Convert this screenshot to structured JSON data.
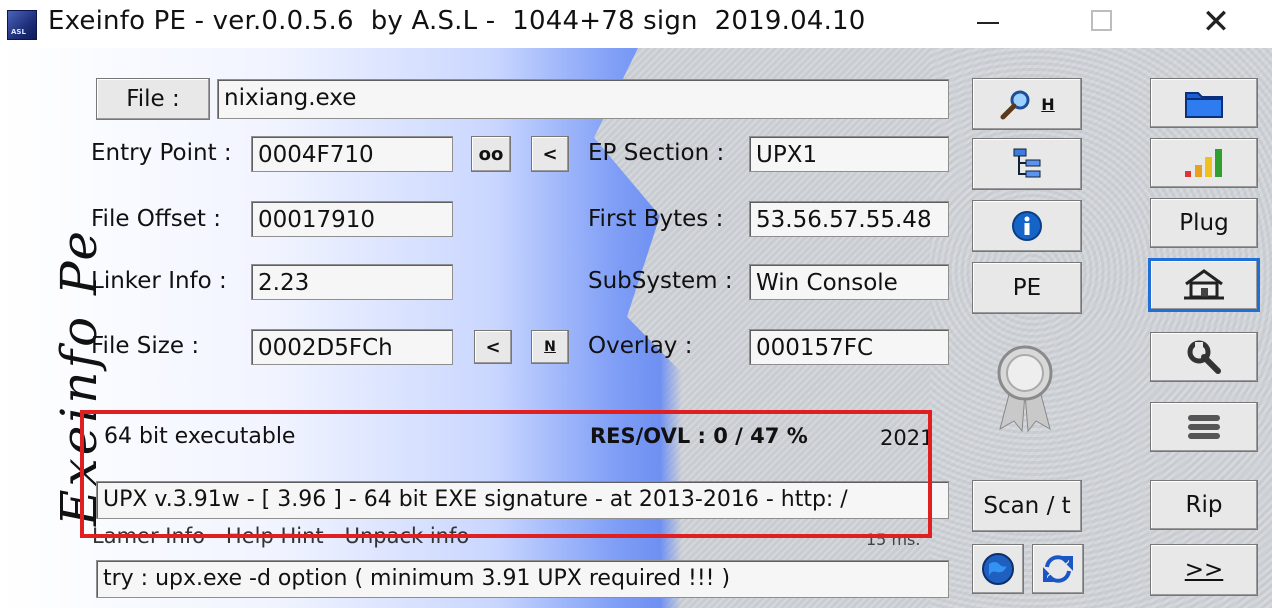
{
  "window": {
    "title": "Exeinfo PE - ver.0.0.5.6  by A.S.L -  1044+78 sign  2019.04.10",
    "icon_text": "ASL",
    "minimize": "–",
    "maximize": "☐",
    "close": "✕"
  },
  "side_logo": "Exeinfo Pe",
  "file": {
    "button_label": "File :",
    "value": "nixiang.exe"
  },
  "fields": {
    "entry_point": {
      "label": "Entry Point :",
      "value": "0004F710"
    },
    "file_offset": {
      "label": "File Offset :",
      "value": "00017910"
    },
    "linker_info": {
      "label": "Linker Info :",
      "value": "2.23"
    },
    "file_size": {
      "label": "File Size :",
      "value": "0002D5FCh"
    },
    "ep_section": {
      "label": "EP Section :",
      "value": "UPX1"
    },
    "first_bytes": {
      "label": "First Bytes :",
      "value": "53.56.57.55.48"
    },
    "subsystem": {
      "label": "SubSystem :",
      "value": "Win Console"
    },
    "overlay": {
      "label": "Overlay :",
      "value": "000157FC"
    }
  },
  "small_buttons": {
    "oo": "oo",
    "lt1": "<",
    "lt2": "<",
    "n": "N"
  },
  "info": {
    "arch": "64 bit executable",
    "res_ovl": "RES/OVL : 0 / 47 %",
    "year": "2021",
    "detection": "UPX v.3.91w - [ 3.96 ] - 64 bit EXE signature  - at  2013-2016 - http: /",
    "lamer_label": "Lamer Info - Help Hint - Unpack info",
    "time": "15 ms.",
    "hint": "try : upx.exe -d option ( minimum 3.91 UPX required !!! )"
  },
  "middle_buttons": {
    "search_h": "H",
    "pe": "PE",
    "scan": "Scan / t"
  },
  "right_buttons": {
    "plug": "Plug",
    "rip": "Rip",
    "next": ">>"
  },
  "icons": [
    "search-icon",
    "tree-icon",
    "info-icon",
    "award-ribbon-icon",
    "globe-icon",
    "refresh-icon",
    "folder-icon",
    "bar-chart-icon",
    "home-icon",
    "wrench-icon",
    "menu-list-icon"
  ],
  "colors": {
    "accent_blue": "#6f90f2",
    "highlight_red": "#e02020",
    "home_border": "#1f6fd6"
  }
}
